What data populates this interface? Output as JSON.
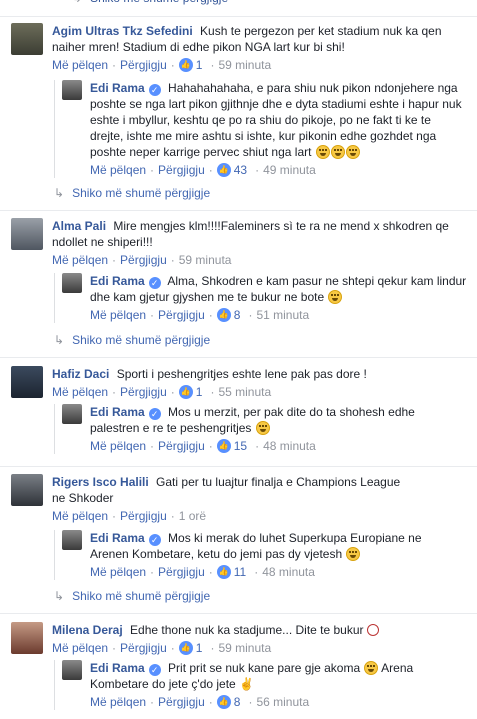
{
  "labels": {
    "like": "Më pëlqen",
    "reply": "Përgjigju",
    "more_replies": "Shiko më shumë përgjigje"
  },
  "comments": [
    {
      "author": "Agim Ultras Tkz Sefedini",
      "text": "Kush te pergezon per ket stadium nuk ka qen naiher mren! Stadium di edhe pikon NGA lart kur bi shi!",
      "likes": "1",
      "time": "59 minuta",
      "reply": {
        "author": "Edi Rama",
        "text": "Hahahahahaha, e para shiu nuk pikon ndonjehere nga poshte se nga lart pikon gjithnje dhe e dyta stadiumi eshte i hapur nuk eshte i mbyllur, keshtu qe po ra shiu do pikoje, po ne fakt ti ke te drejte, ishte me mire ashtu si ishte, kur pikonin edhe gozhdet nga poshte neper karrige pervec shiut nga lart",
        "likes": "43",
        "time": "49 minuta"
      }
    },
    {
      "author": "Alma Pali",
      "text": "Mire mengjes klm!!!!Faleminers sì te ra ne mend x shkodren qe ndollet ne shiperi!!!",
      "time": "59 minuta",
      "reply": {
        "author": "Edi Rama",
        "text": "Alma, Shkodren e kam pasur ne shtepi qekur kam lindur dhe kam gjetur gjyshen me te bukur ne bote",
        "likes": "8",
        "time": "51 minuta"
      }
    },
    {
      "author": "Hafiz Daci",
      "text": "Sporti i peshengritjes eshte lene pak pas dore !",
      "likes": "1",
      "time": "55 minuta",
      "reply": {
        "author": "Edi Rama",
        "text": "Mos u merzit, per pak dite do ta shohesh edhe palestren e re te peshengritjes",
        "likes": "15",
        "time": "48 minuta"
      }
    },
    {
      "author": "Rigers Isco Halili",
      "text": "Gati per tu luajtur finalja e Champions League ne Shkoder",
      "time": "1 orë",
      "reply": {
        "author": "Edi Rama",
        "text": "Mos ki merak do luhet Superkupa Europiane ne Arenen Kombetare, ketu do jemi pas dy vjetesh",
        "likes": "11",
        "time": "48 minuta"
      }
    },
    {
      "author": "Milena Deraj",
      "text": "Edhe thone nuk ka stadjume... Dite te bukur",
      "likes": "1",
      "time": "59 minuta",
      "reply": {
        "author": "Edi Rama",
        "text": "Prit prit se nuk kane pare gje akoma",
        "text2": "Arena Kombetare do jete ç'do jete",
        "likes": "8",
        "time": "56 minuta"
      }
    }
  ]
}
